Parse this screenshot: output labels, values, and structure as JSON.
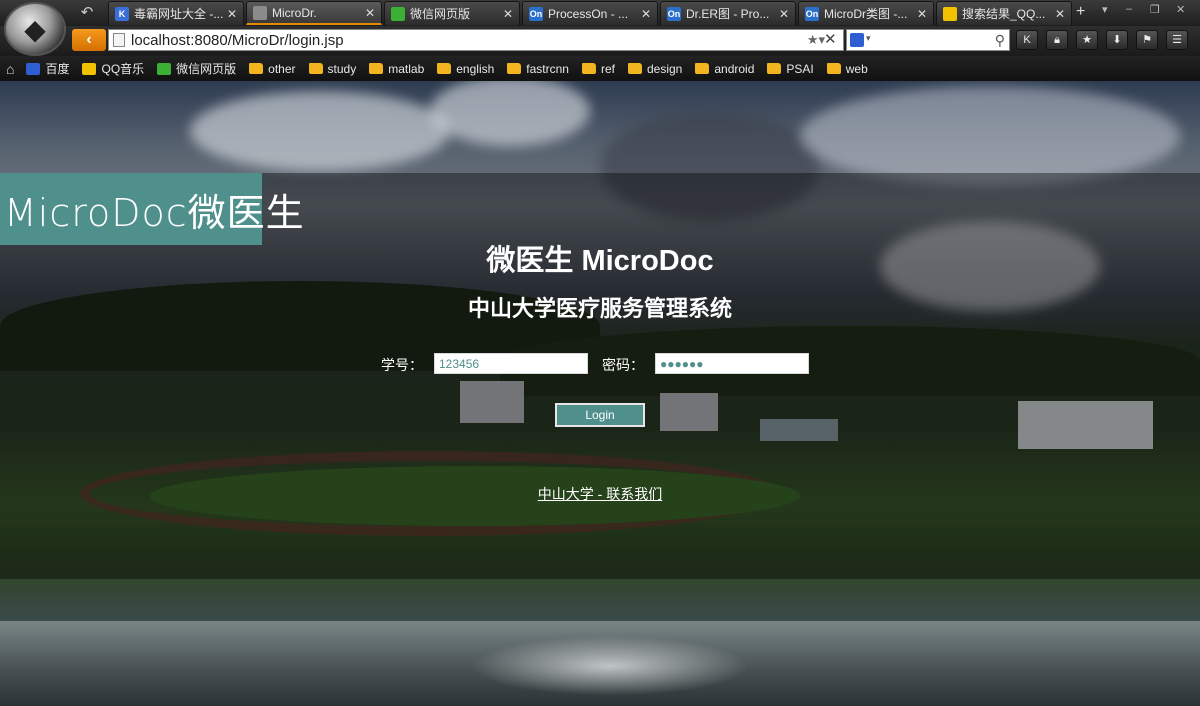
{
  "browser": {
    "tabs": [
      {
        "title": "毒霸网址大全 -...",
        "fav_color": "#3b6fd8",
        "fav_glyph": "K",
        "icon": "kingsoft-icon"
      },
      {
        "title": "MicroDr.",
        "fav_color": "#8b8b8b",
        "fav_glyph": "",
        "icon": "page-icon",
        "active": true
      },
      {
        "title": "微信网页版",
        "fav_color": "#3cb034",
        "fav_glyph": "",
        "icon": "wechat-icon"
      },
      {
        "title": "ProcessOn - ...",
        "fav_color": "#2a6fc9",
        "fav_glyph": "On",
        "icon": "processon-icon"
      },
      {
        "title": "Dr.ER图 - Pro...",
        "fav_color": "#2a6fc9",
        "fav_glyph": "On",
        "icon": "processon-icon"
      },
      {
        "title": "MicroDr类图 -...",
        "fav_color": "#2a6fc9",
        "fav_glyph": "On",
        "icon": "processon-icon"
      },
      {
        "title": "搜索结果_QQ...",
        "fav_color": "#f2c200",
        "fav_glyph": "",
        "icon": "qq-music-icon"
      }
    ],
    "close_glyph": "✕",
    "new_tab_glyph": "+",
    "address": "localhost:8080/MicroDr/login.jsp",
    "bookmarks": [
      {
        "label": "百度",
        "type": "site",
        "color": "#2d5fd3"
      },
      {
        "label": "QQ音乐",
        "type": "site",
        "color": "#f2c200"
      },
      {
        "label": "微信网页版",
        "type": "site",
        "color": "#3cb034"
      },
      {
        "label": "other",
        "type": "folder"
      },
      {
        "label": "study",
        "type": "folder"
      },
      {
        "label": "matlab",
        "type": "folder"
      },
      {
        "label": "english",
        "type": "folder"
      },
      {
        "label": "fastrcnn",
        "type": "folder"
      },
      {
        "label": "ref",
        "type": "folder"
      },
      {
        "label": "design",
        "type": "folder"
      },
      {
        "label": "android",
        "type": "folder"
      },
      {
        "label": "PSAI",
        "type": "folder"
      },
      {
        "label": "web",
        "type": "folder"
      }
    ]
  },
  "page": {
    "brand": "MicroDoc微医生",
    "title": "微医生 MicroDoc",
    "subtitle": "中山大学医疗服务管理系统",
    "student_id_label": "学号：",
    "student_id_value": "123456",
    "password_label": "密码：",
    "password_value": "●●●●●●",
    "login_button": "Login",
    "footer_link": "中山大学 - 联系我们"
  },
  "colors": {
    "accent_teal": "#4f8f8c",
    "nav_orange": "#e28a00"
  }
}
